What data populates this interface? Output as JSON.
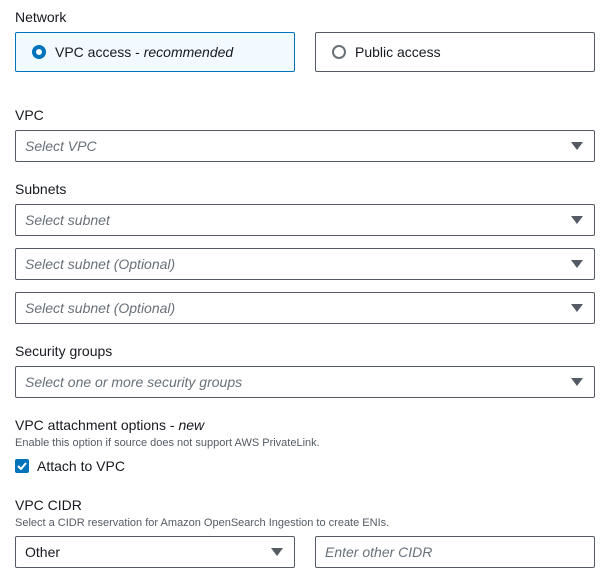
{
  "network": {
    "label": "Network",
    "options": [
      {
        "title": "VPC access",
        "suffix": "recommended",
        "selected": true
      },
      {
        "title": "Public access",
        "selected": false
      }
    ],
    "separator": " - "
  },
  "vpc": {
    "label": "VPC",
    "placeholder": "Select VPC"
  },
  "subnets": {
    "label": "Subnets",
    "fields": [
      {
        "placeholder": "Select subnet"
      },
      {
        "placeholder": "Select subnet (Optional)"
      },
      {
        "placeholder": "Select subnet (Optional)"
      }
    ]
  },
  "security_groups": {
    "label": "Security groups",
    "placeholder": "Select one or more security groups"
  },
  "vpc_attachment": {
    "label": "VPC attachment options",
    "badge": "new",
    "separator": " - ",
    "description": "Enable this option if source does not support AWS PrivateLink.",
    "checkbox_label": "Attach to VPC",
    "checked": true
  },
  "vpc_cidr": {
    "label": "VPC CIDR",
    "description": "Select a CIDR reservation for Amazon OpenSearch Ingestion to create ENIs.",
    "selected_value": "Other",
    "other_placeholder": "Enter other CIDR"
  },
  "colors": {
    "accent": "#0073bb",
    "border": "#545b64",
    "selected_bg": "#f1faff"
  }
}
